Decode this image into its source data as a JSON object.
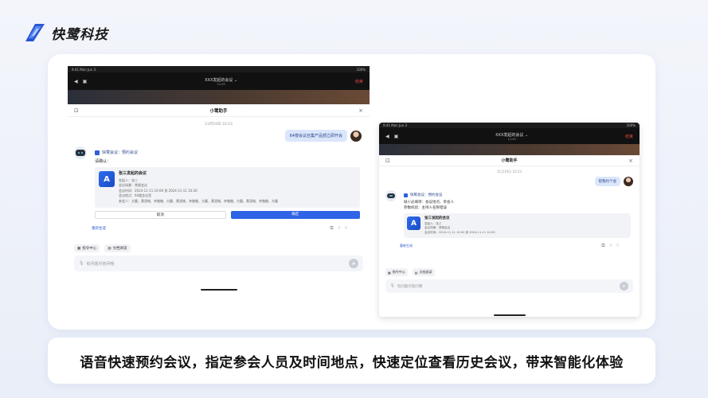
{
  "brand": {
    "name": "快鹭科技"
  },
  "caption": "语音快速预约会议，指定参会人员及时间地点，快速定位查看历史会议，带来智能化体验",
  "colors": {
    "accent": "#2f64e6",
    "user_bubble": "#dbe6fb",
    "exit": "#e74c3c"
  },
  "tablet1": {
    "status": {
      "time": "9:41 Mon Jun 3",
      "battery": "100%"
    },
    "meeting": {
      "title": "XXX发起的会议 ⌄",
      "duration": "11:05",
      "exit": "结束"
    },
    "assistant": {
      "title": "小鹭助手",
      "close": "×"
    },
    "chat": {
      "timestamp": "11月19日 10:23",
      "user_message": "64楼会议召集产品部立即开会",
      "bot": {
        "header": "快鹭会议：预约会议",
        "prompt": "请确认：",
        "card": {
          "logo": "A",
          "title": "张三发起的会议",
          "lines": [
            "发起人：张三",
            "会议场景：常规会议",
            "会议时间：2024-11-11 10:00 到 2024-11-11 10:30",
            "会议地点：64楼会议室",
            "参会人：方圆、黄澄城、李傲傲、方圆、黄澄城、李傲傲、方圆、黄澄城、李傲傲、方圆、黄澄城、李傲傲、方圆"
          ]
        },
        "cancel": "取消",
        "confirm": "确定"
      },
      "regenerate": "重新生成"
    },
    "chips": [
      "指令中心",
      "文档阅读"
    ],
    "input_placeholder": "有问题尽管问哦"
  },
  "tablet2": {
    "status": {
      "time": "9:41 Mon Jun 3",
      "battery": "100%"
    },
    "meeting": {
      "title": "XXX发起的会议 ⌄",
      "duration": "11:05",
      "exit": "结束"
    },
    "assistant": {
      "title": "小鹭助手",
      "close": "×"
    },
    "chat": {
      "timestamp": "11月19日 10:23",
      "user_message": "帮我约个会",
      "bot": {
        "header": "快鹭会议：预约会议",
        "line1": "缺少必填项：会议地点、参会人",
        "line2": "参数校验：主持人名称错误",
        "card": {
          "logo": "A",
          "title": "张三发起的会议",
          "lines": [
            "发起人：张三",
            "会议场景：常规会议",
            "会议时间：2024-11-11 10:00 到 2024-11-11 10:30"
          ]
        }
      },
      "regenerate": "重新生成"
    },
    "chips": [
      "指令中心",
      "文档阅读"
    ],
    "input_placeholder": "有问题尽管问哦"
  }
}
